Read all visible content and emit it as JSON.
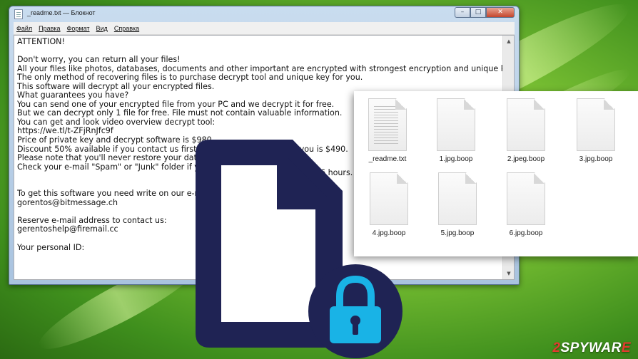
{
  "window": {
    "title": "_readme.txt — Блокнот",
    "buttons": {
      "minimize": "–",
      "maximize": "□",
      "close": "✕"
    }
  },
  "menu": [
    "Файл",
    "Правка",
    "Формат",
    "Вид",
    "Справка"
  ],
  "note_lines": [
    "ATTENTION!",
    "",
    "Don't worry, you can return all your files!",
    "All your files like photos, databases, documents and other important are encrypted with strongest encryption and unique key.",
    "The only method of recovering files is to purchase decrypt tool and unique key for you.",
    "This software will decrypt all your encrypted files.",
    "What guarantees you have?",
    "You can send one of your encrypted file from your PC and we decrypt it for free.",
    "But we can decrypt only 1 file for free. File must not contain valuable information.",
    "You can get and look video overview decrypt tool:",
    "https://we.tl/t-ZFjRnJfc9f",
    "Price of private key and decrypt software is $980.",
    "Discount 50% available if you contact us first 72 hours, that's price for you is $490.",
    "Please note that you'll never restore your data witho",
    "Check your e-mail \"Spam\" or \"Junk\" folder if you",
    "",
    "",
    "To get this software you need write on our e-ma",
    "gorentos@bitmessage.ch",
    "",
    "Reserve e-mail address to contact us:",
    "gerentoshelp@firemail.cc",
    "",
    "Your personal ID:"
  ],
  "note_fragment_right": "6 hours.",
  "files": [
    {
      "name": "_readme.txt",
      "type": "txt"
    },
    {
      "name": "1.jpg.boop",
      "type": "blank"
    },
    {
      "name": "2.jpeg.boop",
      "type": "blank"
    },
    {
      "name": "3.jpg.boop",
      "type": "blank"
    },
    {
      "name": "4.jpg.boop",
      "type": "blank"
    },
    {
      "name": "5.jpg.boop",
      "type": "blank"
    },
    {
      "name": "6.jpg.boop",
      "type": "blank"
    }
  ],
  "overlay": {
    "doc_icon": "document-icon",
    "lock_icon": "padlock-icon",
    "navy": "#1f2354",
    "cyan": "#19b3e6"
  },
  "watermark": {
    "two": "2",
    "rest": "SPYWAR",
    "tail": "E"
  }
}
